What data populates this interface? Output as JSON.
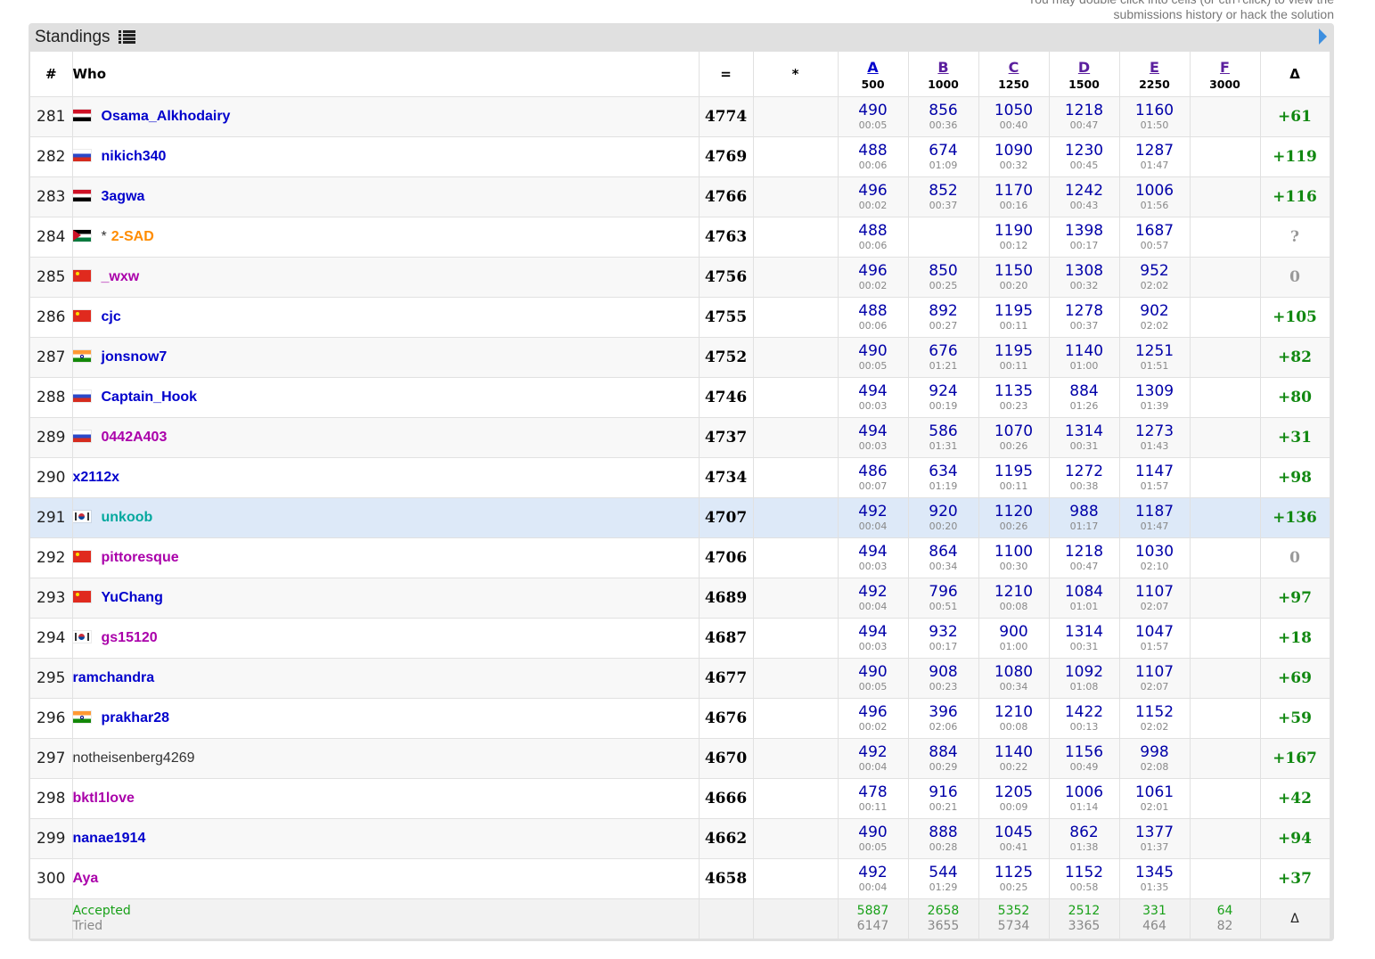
{
  "top_note": {
    "line1": "You may double click into cells (or ctrl+click) to view the",
    "line2": "submissions history or hack the solution"
  },
  "title": "Standings",
  "icons": {
    "title_icon": "list-icon",
    "nav_icon": "arrow-right-icon"
  },
  "columns": {
    "rank": "#",
    "who": "Who",
    "score": "=",
    "hacks": "*",
    "delta": "Δ",
    "problems": [
      {
        "letter": "A",
        "points": "500"
      },
      {
        "letter": "B",
        "points": "1000"
      },
      {
        "letter": "C",
        "points": "1250"
      },
      {
        "letter": "D",
        "points": "1500"
      },
      {
        "letter": "E",
        "points": "2250"
      },
      {
        "letter": "F",
        "points": "3000"
      }
    ]
  },
  "rows": [
    {
      "rank": "281",
      "flag": "eg",
      "handle": "Osama_Alkhodairy",
      "color": "blue",
      "score": "4774",
      "cells": [
        [
          "490",
          "00:05"
        ],
        [
          "856",
          "00:36"
        ],
        [
          "1050",
          "00:40"
        ],
        [
          "1218",
          "00:47"
        ],
        [
          "1160",
          "01:50"
        ],
        [
          "",
          ""
        ]
      ],
      "delta": "+61"
    },
    {
      "rank": "282",
      "flag": "ru",
      "handle": "nikich340",
      "color": "blue",
      "score": "4769",
      "cells": [
        [
          "488",
          "00:06"
        ],
        [
          "674",
          "01:09"
        ],
        [
          "1090",
          "00:32"
        ],
        [
          "1230",
          "00:45"
        ],
        [
          "1287",
          "01:47"
        ],
        [
          "",
          ""
        ]
      ],
      "delta": "+119"
    },
    {
      "rank": "283",
      "flag": "eg",
      "handle": "3agwa",
      "color": "blue",
      "score": "4766",
      "cells": [
        [
          "496",
          "00:02"
        ],
        [
          "852",
          "00:37"
        ],
        [
          "1170",
          "00:16"
        ],
        [
          "1242",
          "00:43"
        ],
        [
          "1006",
          "01:56"
        ],
        [
          "",
          ""
        ]
      ],
      "delta": "+116"
    },
    {
      "rank": "284",
      "flag": "jo",
      "star": "*",
      "handle": "2-SAD",
      "color": "orange",
      "score": "4763",
      "cells": [
        [
          "488",
          "00:06"
        ],
        [
          "",
          ""
        ],
        [
          "1190",
          "00:12"
        ],
        [
          "1398",
          "00:17"
        ],
        [
          "1687",
          "00:57"
        ],
        [
          "",
          ""
        ]
      ],
      "delta": "?"
    },
    {
      "rank": "285",
      "flag": "cn",
      "handle": "_wxw",
      "color": "violet",
      "score": "4756",
      "cells": [
        [
          "496",
          "00:02"
        ],
        [
          "850",
          "00:25"
        ],
        [
          "1150",
          "00:20"
        ],
        [
          "1308",
          "00:32"
        ],
        [
          "952",
          "02:02"
        ],
        [
          "",
          ""
        ]
      ],
      "delta": "0"
    },
    {
      "rank": "286",
      "flag": "cn",
      "handle": "cjc",
      "color": "blue",
      "score": "4755",
      "cells": [
        [
          "488",
          "00:06"
        ],
        [
          "892",
          "00:27"
        ],
        [
          "1195",
          "00:11"
        ],
        [
          "1278",
          "00:37"
        ],
        [
          "902",
          "02:02"
        ],
        [
          "",
          ""
        ]
      ],
      "delta": "+105"
    },
    {
      "rank": "287",
      "flag": "in",
      "handle": "jonsnow7",
      "color": "blue",
      "score": "4752",
      "cells": [
        [
          "490",
          "00:05"
        ],
        [
          "676",
          "01:21"
        ],
        [
          "1195",
          "00:11"
        ],
        [
          "1140",
          "01:00"
        ],
        [
          "1251",
          "01:51"
        ],
        [
          "",
          ""
        ]
      ],
      "delta": "+82"
    },
    {
      "rank": "288",
      "flag": "ru",
      "handle": "Captain_Hook",
      "color": "blue",
      "score": "4746",
      "cells": [
        [
          "494",
          "00:03"
        ],
        [
          "924",
          "00:19"
        ],
        [
          "1135",
          "00:23"
        ],
        [
          "884",
          "01:26"
        ],
        [
          "1309",
          "01:39"
        ],
        [
          "",
          ""
        ]
      ],
      "delta": "+80"
    },
    {
      "rank": "289",
      "flag": "ru",
      "handle": "0442A403",
      "color": "violet",
      "score": "4737",
      "cells": [
        [
          "494",
          "00:03"
        ],
        [
          "586",
          "01:31"
        ],
        [
          "1070",
          "00:26"
        ],
        [
          "1314",
          "00:31"
        ],
        [
          "1273",
          "01:43"
        ],
        [
          "",
          ""
        ]
      ],
      "delta": "+31"
    },
    {
      "rank": "290",
      "flag": "",
      "handle": "x2112x",
      "color": "blue",
      "score": "4734",
      "cells": [
        [
          "486",
          "00:07"
        ],
        [
          "634",
          "01:19"
        ],
        [
          "1195",
          "00:11"
        ],
        [
          "1272",
          "00:38"
        ],
        [
          "1147",
          "01:57"
        ],
        [
          "",
          ""
        ]
      ],
      "delta": "+98"
    },
    {
      "rank": "291",
      "flag": "kr",
      "handle": "unkoob",
      "color": "cyan",
      "score": "4707",
      "cells": [
        [
          "492",
          "00:04"
        ],
        [
          "920",
          "00:20"
        ],
        [
          "1120",
          "00:26"
        ],
        [
          "988",
          "01:17"
        ],
        [
          "1187",
          "01:47"
        ],
        [
          "",
          ""
        ]
      ],
      "delta": "+136"
    },
    {
      "rank": "292",
      "flag": "cn",
      "handle": "pittoresque",
      "color": "violet",
      "score": "4706",
      "cells": [
        [
          "494",
          "00:03"
        ],
        [
          "864",
          "00:34"
        ],
        [
          "1100",
          "00:30"
        ],
        [
          "1218",
          "00:47"
        ],
        [
          "1030",
          "02:10"
        ],
        [
          "",
          ""
        ]
      ],
      "delta": "0"
    },
    {
      "rank": "293",
      "flag": "cn",
      "handle": "YuChang",
      "color": "blue",
      "score": "4689",
      "cells": [
        [
          "492",
          "00:04"
        ],
        [
          "796",
          "00:51"
        ],
        [
          "1210",
          "00:08"
        ],
        [
          "1084",
          "01:01"
        ],
        [
          "1107",
          "02:07"
        ],
        [
          "",
          ""
        ]
      ],
      "delta": "+97"
    },
    {
      "rank": "294",
      "flag": "kr",
      "handle": "gs15120",
      "color": "violet",
      "score": "4687",
      "cells": [
        [
          "494",
          "00:03"
        ],
        [
          "932",
          "00:17"
        ],
        [
          "900",
          "01:00"
        ],
        [
          "1314",
          "00:31"
        ],
        [
          "1047",
          "01:57"
        ],
        [
          "",
          ""
        ]
      ],
      "delta": "+18"
    },
    {
      "rank": "295",
      "flag": "",
      "handle": "ramchandra",
      "color": "blue",
      "score": "4677",
      "cells": [
        [
          "490",
          "00:05"
        ],
        [
          "908",
          "00:23"
        ],
        [
          "1080",
          "00:34"
        ],
        [
          "1092",
          "01:08"
        ],
        [
          "1107",
          "02:07"
        ],
        [
          "",
          ""
        ]
      ],
      "delta": "+69"
    },
    {
      "rank": "296",
      "flag": "in",
      "handle": "prakhar28",
      "color": "blue",
      "score": "4676",
      "cells": [
        [
          "496",
          "00:02"
        ],
        [
          "396",
          "02:06"
        ],
        [
          "1210",
          "00:08"
        ],
        [
          "1422",
          "00:13"
        ],
        [
          "1152",
          "02:02"
        ],
        [
          "",
          ""
        ]
      ],
      "delta": "+59"
    },
    {
      "rank": "297",
      "flag": "",
      "handle": "notheisenberg4269",
      "color": "gray",
      "score": "4670",
      "cells": [
        [
          "492",
          "00:04"
        ],
        [
          "884",
          "00:29"
        ],
        [
          "1140",
          "00:22"
        ],
        [
          "1156",
          "00:49"
        ],
        [
          "998",
          "02:08"
        ],
        [
          "",
          ""
        ]
      ],
      "delta": "+167"
    },
    {
      "rank": "298",
      "flag": "",
      "handle": "bktl1love",
      "color": "violet",
      "score": "4666",
      "cells": [
        [
          "478",
          "00:11"
        ],
        [
          "916",
          "00:21"
        ],
        [
          "1205",
          "00:09"
        ],
        [
          "1006",
          "01:14"
        ],
        [
          "1061",
          "02:01"
        ],
        [
          "",
          ""
        ]
      ],
      "delta": "+42"
    },
    {
      "rank": "299",
      "flag": "",
      "handle": "nanae1914",
      "color": "blue",
      "score": "4662",
      "cells": [
        [
          "490",
          "00:05"
        ],
        [
          "888",
          "00:28"
        ],
        [
          "1045",
          "00:41"
        ],
        [
          "862",
          "01:38"
        ],
        [
          "1377",
          "01:37"
        ],
        [
          "",
          ""
        ]
      ],
      "delta": "+94"
    },
    {
      "rank": "300",
      "flag": "",
      "handle": "Aya",
      "color": "violet",
      "score": "4658",
      "cells": [
        [
          "492",
          "00:04"
        ],
        [
          "544",
          "01:29"
        ],
        [
          "1125",
          "00:25"
        ],
        [
          "1152",
          "00:58"
        ],
        [
          "1345",
          "01:35"
        ],
        [
          "",
          ""
        ]
      ],
      "delta": "+37"
    }
  ],
  "footer": {
    "accepted_label": "Accepted",
    "tried_label": "Tried",
    "accepted": [
      "5887",
      "2658",
      "5352",
      "2512",
      "331",
      "64"
    ],
    "tried": [
      "6147",
      "3655",
      "5734",
      "3365",
      "464",
      "82"
    ],
    "delta_label": "Δ"
  },
  "colors": {
    "handle_blue": "#0000cc",
    "handle_violet": "#aa00aa",
    "handle_orange": "#ff8c00",
    "handle_cyan": "#03a89e",
    "delta_positive": "#118811",
    "highlight_row": "#dde9f8"
  }
}
